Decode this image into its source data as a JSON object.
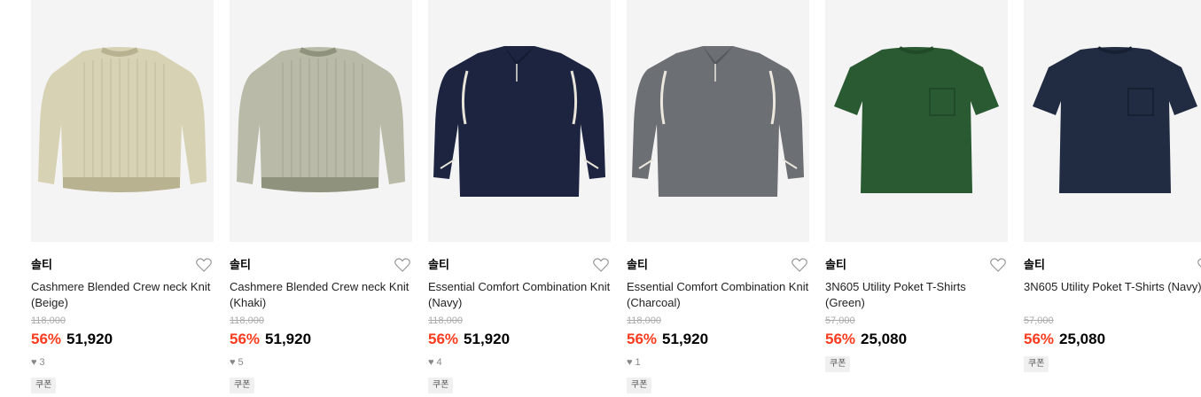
{
  "products": [
    {
      "brand": "솔티",
      "name": "Cashmere Blended Crew neck Knit (Beige)",
      "original_price": "118,000",
      "discount": "56%",
      "price": "51,920",
      "likes": "3",
      "coupon": "쿠폰",
      "image": "beige-crewneck-knit",
      "colors": {
        "main": "#d8d2b4",
        "shade": "#b9b291"
      }
    },
    {
      "brand": "솔티",
      "name": "Cashmere Blended Crew neck Knit (Khaki)",
      "original_price": "118,000",
      "discount": "56%",
      "price": "51,920",
      "likes": "5",
      "coupon": "쿠폰",
      "image": "khaki-crewneck-knit",
      "colors": {
        "main": "#b9bba8",
        "shade": "#8f937d"
      }
    },
    {
      "brand": "솔티",
      "name": "Essential Comfort Combination Knit (Navy)",
      "original_price": "118,000",
      "discount": "56%",
      "price": "51,920",
      "likes": "4",
      "coupon": "쿠폰",
      "image": "navy-collar-knit",
      "colors": {
        "main": "#1c2440",
        "shade": "#141a30"
      }
    },
    {
      "brand": "솔티",
      "name": "Essential Comfort Combination Knit (Charcoal)",
      "original_price": "118,000",
      "discount": "56%",
      "price": "51,920",
      "likes": "1",
      "coupon": "쿠폰",
      "image": "charcoal-collar-knit",
      "colors": {
        "main": "#6c6f74",
        "shade": "#55585c"
      }
    },
    {
      "brand": "솔티",
      "name": "3N605 Utility Poket T-Shirts (Green)",
      "original_price": "57,000",
      "discount": "56%",
      "price": "25,080",
      "likes": "",
      "coupon": "쿠폰",
      "image": "green-pocket-tshirt",
      "colors": {
        "main": "#2a5a32",
        "shade": "#214a28"
      }
    },
    {
      "brand": "솔티",
      "name": "3N605 Utility Poket T-Shirts (Navy)",
      "original_price": "57,000",
      "discount": "56%",
      "price": "25,080",
      "likes": "",
      "coupon": "쿠폰",
      "image": "navy-pocket-tshirt",
      "colors": {
        "main": "#212c42",
        "shade": "#182033"
      }
    }
  ],
  "accent": {
    "discount": "#ff3b1f"
  }
}
